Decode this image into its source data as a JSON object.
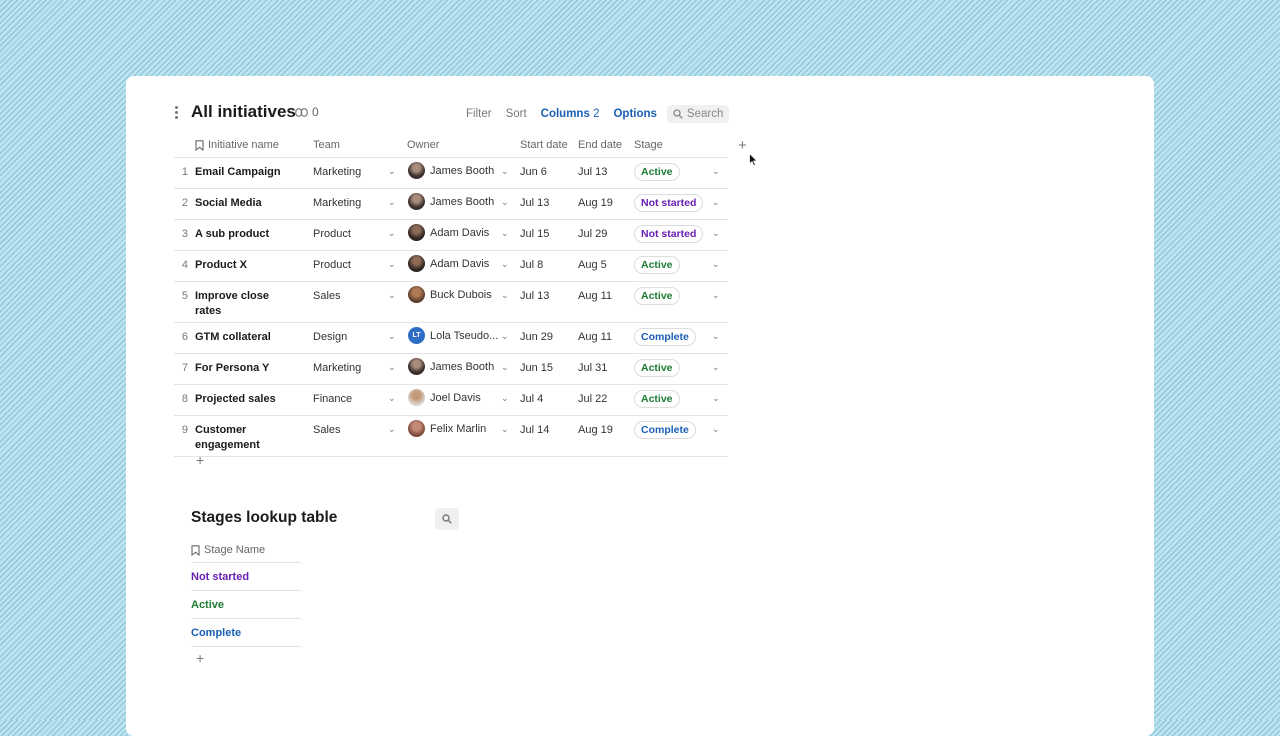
{
  "colors": {
    "active": "#1e7b34",
    "not_started": "#6a1fb3",
    "complete": "#1a5fb4",
    "accent": "#1a5fb4"
  },
  "header": {
    "title": "All initiatives",
    "link_count": "0",
    "toolbar": {
      "filter": "Filter",
      "sort": "Sort",
      "columns": "Columns",
      "columns_count": "2",
      "options": "Options",
      "search": "Search"
    }
  },
  "table": {
    "columns": [
      "Initiative name",
      "Team",
      "Owner",
      "Start date",
      "End date",
      "Stage"
    ],
    "rows": [
      {
        "idx": "1",
        "name": "Email Campaign",
        "team": "Marketing",
        "owner": "James Booth",
        "start": "Jun 6",
        "end": "Jul 13",
        "stage": "Active"
      },
      {
        "idx": "2",
        "name": "Social Media",
        "team": "Marketing",
        "owner": "James Booth",
        "start": "Jul 13",
        "end": "Aug 19",
        "stage": "Not started"
      },
      {
        "idx": "3",
        "name": "A sub product",
        "team": "Product",
        "owner": "Adam Davis",
        "start": "Jul 15",
        "end": "Jul 29",
        "stage": "Not started"
      },
      {
        "idx": "4",
        "name": "Product X",
        "team": "Product",
        "owner": "Adam Davis",
        "start": "Jul 8",
        "end": "Aug 5",
        "stage": "Active"
      },
      {
        "idx": "5",
        "name": "Improve close rates",
        "team": "Sales",
        "owner": "Buck Dubois",
        "start": "Jul 13",
        "end": "Aug 11",
        "stage": "Active"
      },
      {
        "idx": "6",
        "name": "GTM collateral",
        "team": "Design",
        "owner": "Lola Tseudo...",
        "owner_initials": "LT",
        "start": "Jun 29",
        "end": "Aug 11",
        "stage": "Complete"
      },
      {
        "idx": "7",
        "name": "For Persona Y",
        "team": "Marketing",
        "owner": "James Booth",
        "start": "Jun 15",
        "end": "Jul 31",
        "stage": "Active"
      },
      {
        "idx": "8",
        "name": "Projected sales",
        "team": "Finance",
        "owner": "Joel Davis",
        "start": "Jul 4",
        "end": "Jul 22",
        "stage": "Active"
      },
      {
        "idx": "9",
        "name": "Customer engagement",
        "team": "Sales",
        "owner": "Felix Marlin",
        "start": "Jul 14",
        "end": "Aug 19",
        "stage": "Complete"
      }
    ]
  },
  "lookup": {
    "title": "Stages lookup table",
    "column": "Stage Name",
    "rows": [
      "Not started",
      "Active",
      "Complete"
    ]
  }
}
